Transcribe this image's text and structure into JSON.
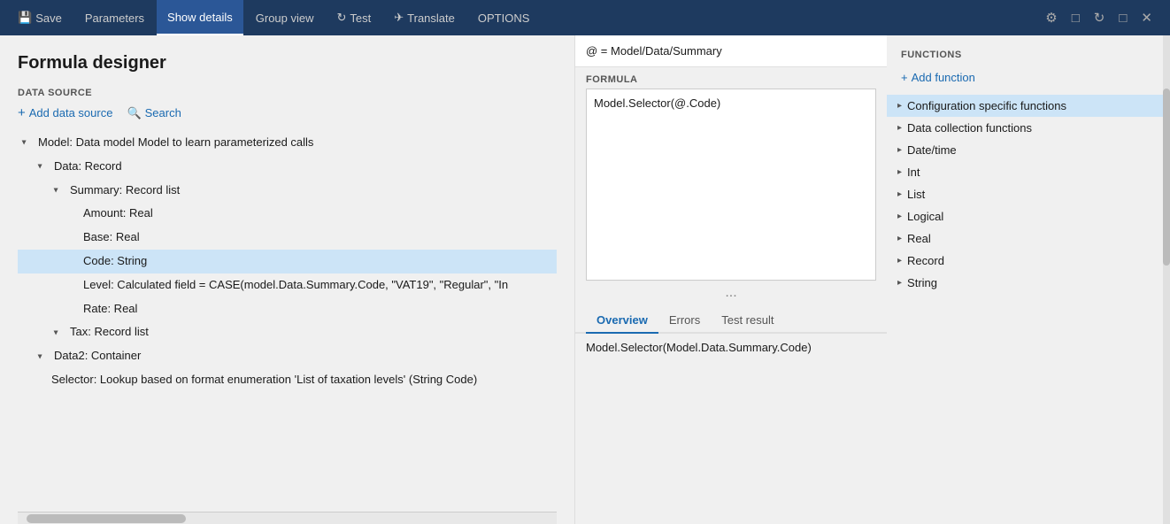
{
  "titlebar": {
    "save_label": "Save",
    "parameters_label": "Parameters",
    "show_details_label": "Show details",
    "group_view_label": "Group view",
    "test_label": "Test",
    "translate_label": "Translate",
    "options_label": "OPTIONS"
  },
  "left_panel": {
    "title": "Formula designer",
    "data_source_label": "DATA SOURCE",
    "add_data_source_label": "Add data source",
    "search_label": "Search",
    "tree": [
      {
        "id": "model",
        "level": 0,
        "icon": "▸",
        "expanded": true,
        "text": "Model: Data model Model to learn parameterized calls"
      },
      {
        "id": "data",
        "level": 1,
        "icon": "▸",
        "expanded": true,
        "text": "Data: Record"
      },
      {
        "id": "summary",
        "level": 2,
        "icon": "▸",
        "expanded": true,
        "text": "Summary: Record list"
      },
      {
        "id": "amount",
        "level": 3,
        "icon": "",
        "expanded": false,
        "text": "Amount: Real"
      },
      {
        "id": "base",
        "level": 3,
        "icon": "",
        "expanded": false,
        "text": "Base: Real"
      },
      {
        "id": "code",
        "level": 3,
        "icon": "",
        "expanded": false,
        "text": "Code: String",
        "highlighted": true
      },
      {
        "id": "level",
        "level": 3,
        "icon": "",
        "expanded": false,
        "text": "Level: Calculated field = CASE(model.Data.Summary.Code, \"VAT19\", \"Regular\", \"In"
      },
      {
        "id": "rate",
        "level": 3,
        "icon": "",
        "expanded": false,
        "text": "Rate: Real"
      },
      {
        "id": "tax",
        "level": 2,
        "icon": "▸",
        "expanded": false,
        "text": "Tax: Record list"
      },
      {
        "id": "data2",
        "level": 1,
        "icon": "▸",
        "expanded": false,
        "text": "Data2: Container"
      },
      {
        "id": "selector",
        "level": 1,
        "icon": "",
        "expanded": false,
        "text": "Selector: Lookup based on format enumeration 'List of taxation levels' (String Code)"
      }
    ]
  },
  "center_panel": {
    "path": "@ = Model/Data/Summary",
    "formula_label": "FORMULA",
    "formula_value": "Model.Selector(@.Code)",
    "tabs": [
      "Overview",
      "Errors",
      "Test result"
    ],
    "active_tab": "Overview",
    "result_value": "Model.Selector(Model.Data.Summary.Code)"
  },
  "right_panel": {
    "functions_label": "FUNCTIONS",
    "add_function_label": "Add function",
    "functions": [
      {
        "id": "config",
        "label": "Configuration specific functions",
        "selected": true
      },
      {
        "id": "datacollection",
        "label": "Data collection functions",
        "selected": false
      },
      {
        "id": "datetime",
        "label": "Date/time",
        "selected": false
      },
      {
        "id": "int",
        "label": "Int",
        "selected": false
      },
      {
        "id": "list",
        "label": "List",
        "selected": false
      },
      {
        "id": "logical",
        "label": "Logical",
        "selected": false
      },
      {
        "id": "real",
        "label": "Real",
        "selected": false
      },
      {
        "id": "record",
        "label": "Record",
        "selected": false
      },
      {
        "id": "string",
        "label": "String",
        "selected": false
      }
    ]
  }
}
